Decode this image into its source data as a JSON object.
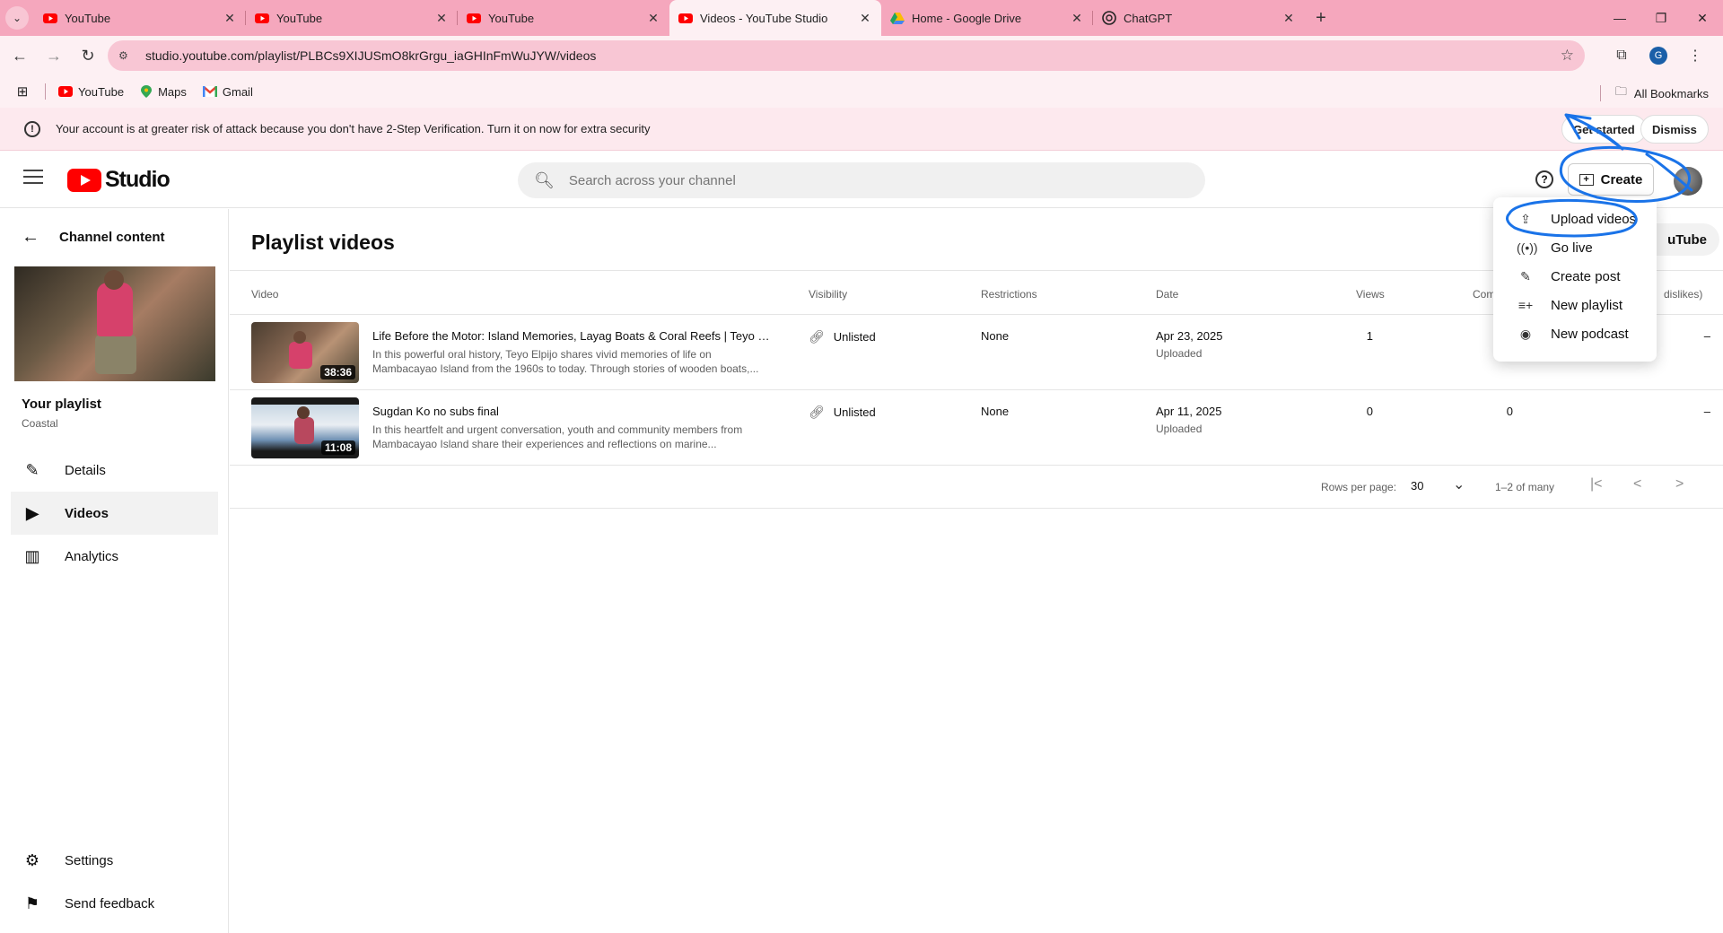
{
  "browser": {
    "tabs": [
      {
        "title": "YouTube",
        "icon": "youtube-icon",
        "active": false
      },
      {
        "title": "YouTube",
        "icon": "youtube-icon",
        "active": false
      },
      {
        "title": "YouTube",
        "icon": "youtube-icon",
        "active": false
      },
      {
        "title": "Videos - YouTube Studio",
        "icon": "youtube-icon",
        "active": true
      },
      {
        "title": "Home - Google Drive",
        "icon": "drive-icon",
        "active": false
      },
      {
        "title": "ChatGPT",
        "icon": "chatgpt-icon",
        "active": false
      }
    ],
    "url": "studio.youtube.com/playlist/PLBCs9XIJUSmO8krGrgu_iaGHInFmWuJYW/videos",
    "profile_initial": "G",
    "bookmarks": [
      "YouTube",
      "Maps",
      "Gmail"
    ],
    "all_bookmarks": "All Bookmarks"
  },
  "banner": {
    "message": "Your account is at greater risk of attack because you don't have 2-Step Verification. Turn it on now for extra security",
    "get_started": "Get started",
    "dismiss": "Dismiss"
  },
  "header": {
    "logo_text": "Studio",
    "search_placeholder": "Search across your channel",
    "create_label": "Create"
  },
  "sidebar": {
    "back_label": "Channel content",
    "playlist_title": "Your playlist",
    "playlist_subtitle": "Coastal",
    "nav": [
      {
        "label": "Details",
        "icon": "pencil-icon"
      },
      {
        "label": "Videos",
        "icon": "video-icon",
        "active": true
      },
      {
        "label": "Analytics",
        "icon": "analytics-icon"
      }
    ],
    "settings": "Settings",
    "feedback": "Send feedback"
  },
  "main": {
    "title": "Playlist videos",
    "partial_button": "uTube",
    "columns": {
      "video": "Video",
      "visibility": "Visibility",
      "restrictions": "Restrictions",
      "date": "Date",
      "views": "Views",
      "comments": "Com",
      "likes": "dislikes)"
    },
    "rows": [
      {
        "title": "Life Before the Motor: Island Memories, Layag Boats & Coral Reefs | Teyo El...",
        "description": "In this powerful oral history, Teyo Elpijo shares vivid memories of life on Mambacayao Island from the 1960s to today. Through stories of wooden boats,...",
        "duration": "38:36",
        "visibility": "Unlisted",
        "restrictions": "None",
        "date": "Apr 23, 2025",
        "date_sub": "Uploaded",
        "views": "1",
        "comments": "",
        "likes": "–"
      },
      {
        "title": "Sugdan Ko no subs final",
        "description": "In this heartfelt and urgent conversation, youth and community members from Mambacayao Island share their experiences and reflections on marine...",
        "duration": "11:08",
        "visibility": "Unlisted",
        "restrictions": "None",
        "date": "Apr 11, 2025",
        "date_sub": "Uploaded",
        "views": "0",
        "comments": "0",
        "likes": "–"
      }
    ],
    "pager": {
      "rows_label": "Rows per page:",
      "rows_value": "30",
      "range": "1–2 of many"
    }
  },
  "create_menu": {
    "items": [
      {
        "label": "Upload videos",
        "icon": "upload-icon"
      },
      {
        "label": "Go live",
        "icon": "live-icon"
      },
      {
        "label": "Create post",
        "icon": "post-icon"
      },
      {
        "label": "New playlist",
        "icon": "playlist-add-icon"
      },
      {
        "label": "New podcast",
        "icon": "podcast-icon"
      }
    ]
  },
  "colors": {
    "tabstrip": "#f5a7bd",
    "toolbar": "#fdf0f3",
    "banner": "#fde9ee",
    "brand_red": "#ff0000",
    "annotation_blue": "#1a73e8"
  }
}
